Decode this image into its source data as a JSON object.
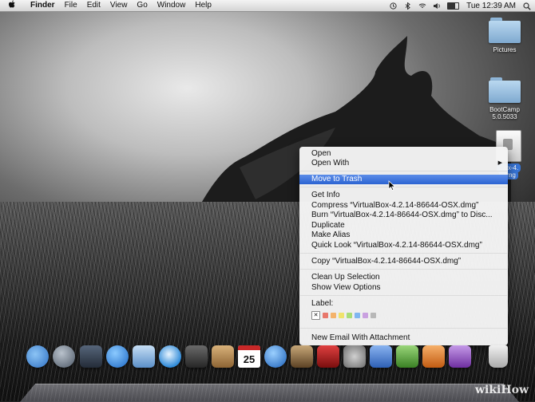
{
  "menubar": {
    "apple_icon": "",
    "app_name": "Finder",
    "menus": [
      "File",
      "Edit",
      "View",
      "Go",
      "Window",
      "Help"
    ],
    "clock": "Tue 12:39 AM",
    "status_icons": [
      "time-machine-icon",
      "bluetooth-icon",
      "wifi-icon",
      "volume-icon",
      "battery-icon",
      "spotlight-icon"
    ]
  },
  "desktop_icons": [
    {
      "label": "Pictures",
      "type": "folder"
    },
    {
      "label": "BootCamp5.0.5033",
      "type": "folder"
    },
    {
      "label": "...ox-4.",
      "label2": ".dmg",
      "type": "dmg"
    }
  ],
  "context_menu": {
    "open": "Open",
    "open_with": "Open With",
    "move_to_trash": "Move to Trash",
    "get_info": "Get Info",
    "compress": "Compress “VirtualBox-4.2.14-86644-OSX.dmg”",
    "burn": "Burn “VirtualBox-4.2.14-86644-OSX.dmg” to Disc...",
    "duplicate": "Duplicate",
    "make_alias": "Make Alias",
    "quick_look": "Quick Look “VirtualBox-4.2.14-86644-OSX.dmg”",
    "copy": "Copy “VirtualBox-4.2.14-86644-OSX.dmg”",
    "clean_up": "Clean Up Selection",
    "show_view_options": "Show View Options",
    "label_heading": "Label:",
    "label_colors": [
      "#e8776b",
      "#f4b36b",
      "#efe36b",
      "#a8dc78",
      "#7fb6f0",
      "#c9a0e0",
      "#b8b8b8"
    ],
    "new_email": "New Email With Attachment"
  },
  "dock": {
    "items": [
      {
        "name": "finder-icon",
        "color": "#4a90e2"
      },
      {
        "name": "launchpad-icon",
        "color": "#6d7a8a"
      },
      {
        "name": "mission-control-icon",
        "color": "#3a4658"
      },
      {
        "name": "app-store-icon",
        "color": "#2f86dd"
      },
      {
        "name": "mail-icon",
        "color": "#7ab0e8"
      },
      {
        "name": "safari-icon",
        "color": "#3ea0e8"
      },
      {
        "name": "facetime-icon",
        "color": "#444"
      },
      {
        "name": "contacts-icon",
        "color": "#b48a50"
      },
      {
        "name": "calendar-icon",
        "color": "#ffffff",
        "text": "25"
      },
      {
        "name": "itunes-icon",
        "color": "#2f7bd6"
      },
      {
        "name": "iphoto-icon",
        "color": "#8a6a40"
      },
      {
        "name": "photo-booth-icon",
        "color": "#b01e1e"
      },
      {
        "name": "system-preferences-icon",
        "color": "#8c8c8c"
      },
      {
        "name": "word-icon",
        "color": "#4a78c8"
      },
      {
        "name": "excel-icon",
        "color": "#5da23f"
      },
      {
        "name": "powerpoint-icon",
        "color": "#e07a2a"
      },
      {
        "name": "entourage-icon",
        "color": "#9a5bc4"
      },
      {
        "name": "downloads-icon",
        "color": "#d8d8d8"
      },
      {
        "name": "trash-icon",
        "color": "#dcdcdc"
      }
    ]
  },
  "watermark": "wikiHow"
}
